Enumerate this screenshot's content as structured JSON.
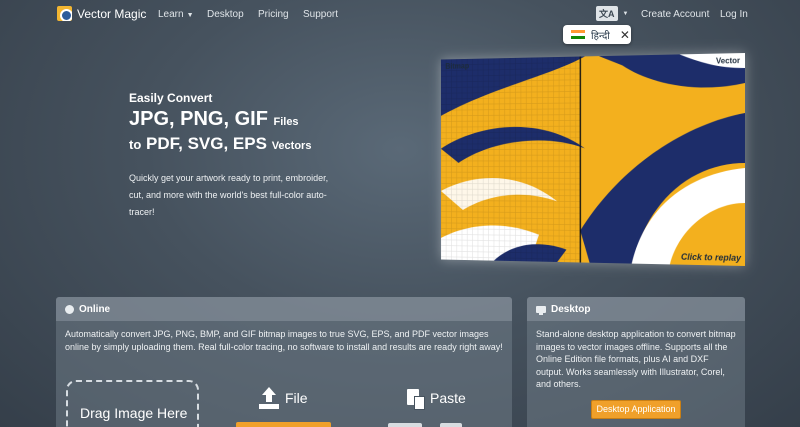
{
  "nav": {
    "brand": "Vector Magic",
    "learn": "Learn",
    "desktop": "Desktop",
    "pricing": "Pricing",
    "support": "Support",
    "language_icon": "translate-icon",
    "create_account": "Create Account",
    "login": "Log In"
  },
  "language_popup": {
    "label": "हिन्दी",
    "close": "✕"
  },
  "hero": {
    "kicker": "Easily Convert",
    "formats_from": "JPG, PNG, GIF",
    "files_word": "Files",
    "to_word": "to",
    "formats_to": "PDF, SVG, EPS",
    "vectors_word": "Vectors",
    "description": "Quickly get your artwork ready to print, embroider, cut, and more with the world's best full-color auto-tracer!"
  },
  "demo": {
    "bitmap_label": "Bitmap",
    "vector_label": "Vector",
    "replay_label": "Click to replay"
  },
  "online_panel": {
    "title": "Online",
    "description": "Automatically convert JPG, PNG, BMP, and GIF bitmap images to true SVG, EPS, and PDF vector images online by simply uploading them. Real full-color tracing, no software to install and results are ready right away!",
    "drop_label": "Drag Image Here",
    "file_label": "File",
    "paste_label": "Paste"
  },
  "desktop_panel": {
    "title": "Desktop",
    "description": "Stand-alone desktop application to convert bitmap images to vector images offline. Supports all the Online Edition file formats, plus AI and DXF output. Works seamlessly with Illustrator, Corel, and others.",
    "button": "Desktop Application"
  },
  "colors": {
    "accent_orange": "#f0a02a",
    "logo_yellow": "#f2b632",
    "logo_navy": "#1d2d5a"
  }
}
